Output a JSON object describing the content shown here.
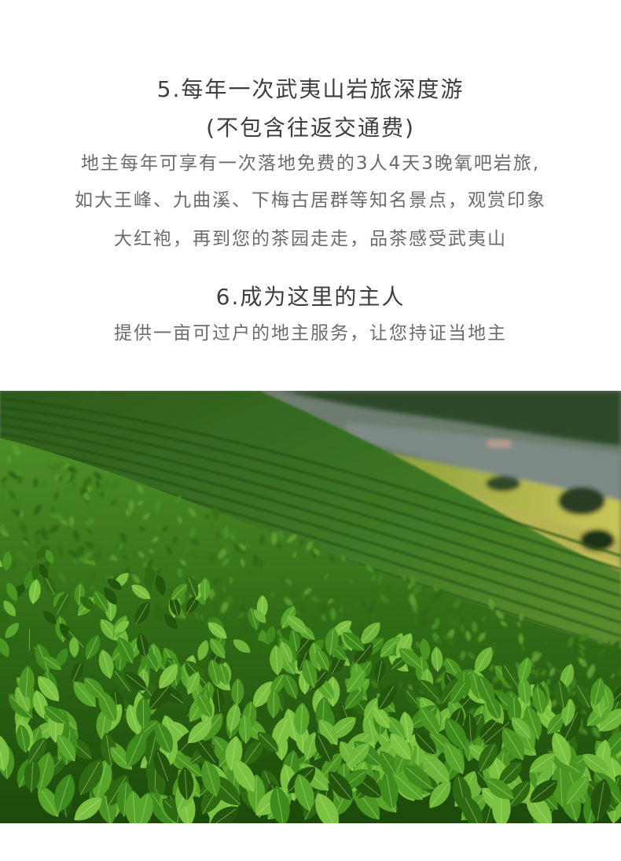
{
  "section5": {
    "title": "5.每年一次武夷山岩旅深度游",
    "subtitle": "(不包含往返交通费)",
    "lines": [
      "地主每年可享有一次落地免费的3人4天3晚氧吧岩旅,",
      "如大王峰、九曲溪、下梅古居群等知名景点，观赏印象",
      "大红袍，再到您的茶园走走，品茶感受武夷山"
    ]
  },
  "section6": {
    "title": "6.成为这里的主人",
    "lines": [
      "提供一亩可过户的地主服务，让您持证当地主"
    ]
  },
  "photo": {
    "subject": "tea-plantation",
    "colors": {
      "sky": "#5e7066",
      "far_hill": "#36522c",
      "terrace": "#3e7424",
      "field": "#a8b84a",
      "leaf_dark": "#1f4a0e",
      "leaf_mid": "#3f8a1c",
      "leaf_light": "#7cc242"
    }
  }
}
